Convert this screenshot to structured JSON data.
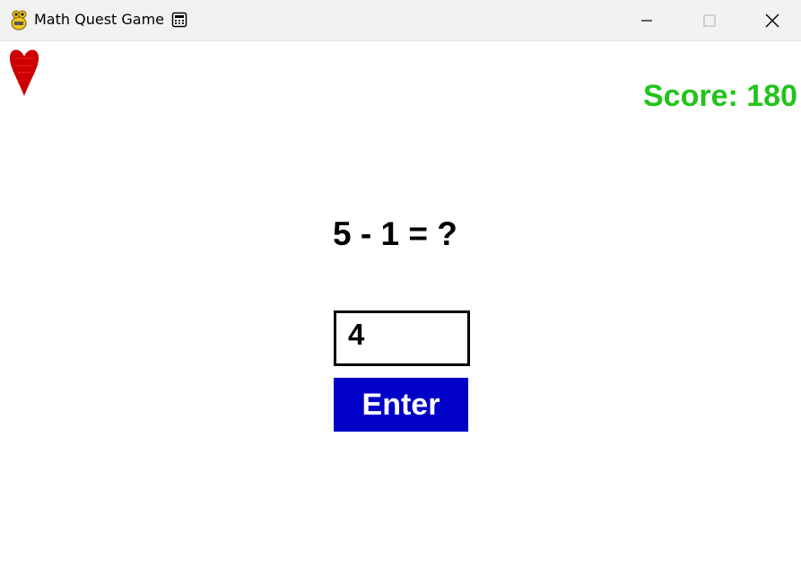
{
  "window": {
    "title": "Math Quest Game",
    "app_icon": "pygame-snake-icon",
    "title_badge_icon": "calculator-icon",
    "controls": [
      "minimize-icon",
      "maximize-icon",
      "close-icon"
    ]
  },
  "game": {
    "lives_icon": "heart-icon",
    "lives_color": "#cc0000",
    "score_label": "Score: 180",
    "score_color": "#22c41b",
    "question": "5 - 1 = ?",
    "answer_value": "4",
    "enter_label": "Enter",
    "enter_button_color": "#0000c8"
  }
}
